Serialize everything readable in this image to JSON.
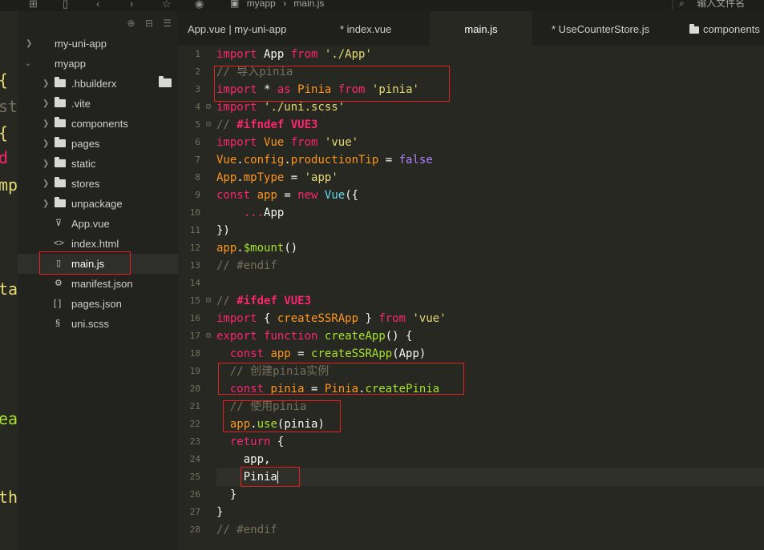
{
  "toolbar": {
    "icons": [
      "new-file-icon",
      "save-icon",
      "back-icon",
      "forward-icon",
      "star-icon",
      "run-icon"
    ],
    "breadcrumb": [
      "myapp",
      "main.js"
    ],
    "file_search_placeholder": "输入文件名"
  },
  "sidebar": {
    "items": [
      {
        "label": "my-uni-app",
        "type": "project",
        "icon": "chevron-right-icon"
      },
      {
        "label": "myapp",
        "type": "project",
        "icon": "chevron-down-icon"
      },
      {
        "label": ".hbuilderx",
        "type": "folder",
        "icon": "folder-icon"
      },
      {
        "label": ".vite",
        "type": "folder",
        "icon": "folder-icon"
      },
      {
        "label": "components",
        "type": "folder",
        "icon": "folder-icon"
      },
      {
        "label": "pages",
        "type": "folder",
        "icon": "folder-icon"
      },
      {
        "label": "static",
        "type": "folder",
        "icon": "folder-icon"
      },
      {
        "label": "stores",
        "type": "folder",
        "icon": "folder-icon"
      },
      {
        "label": "unpackage",
        "type": "folder",
        "icon": "folder-icon"
      },
      {
        "label": "App.vue",
        "type": "file",
        "icon": "vue-file-icon"
      },
      {
        "label": "index.html",
        "type": "file",
        "icon": "html-file-icon"
      },
      {
        "label": "main.js",
        "type": "file",
        "icon": "js-file-icon"
      },
      {
        "label": "manifest.json",
        "type": "file",
        "icon": "manifest-file-icon"
      },
      {
        "label": "pages.json",
        "type": "file",
        "icon": "json-file-icon"
      },
      {
        "label": "uni.scss",
        "type": "file",
        "icon": "scss-file-icon"
      }
    ]
  },
  "left_strip": [
    "{",
    "st",
    "{",
    "d",
    "mp",
    "ta",
    "ea",
    "th"
  ],
  "tabs": [
    {
      "label": "App.vue | my-uni-app"
    },
    {
      "label": "* index.vue"
    },
    {
      "label": "main.js"
    },
    {
      "label": "* UseCounterStore.js"
    },
    {
      "label": "components"
    }
  ],
  "editor": {
    "line_numbers": [
      "1",
      "2",
      "3",
      "4",
      "5",
      "6",
      "7",
      "8",
      "9",
      "10",
      "11",
      "12",
      "13",
      "14",
      "15",
      "16",
      "17",
      "18",
      "19",
      "20",
      "21",
      "22",
      "23",
      "24",
      "25",
      "26",
      "27",
      "28"
    ],
    "tokens": [
      [
        [
          "kw",
          "import"
        ],
        [
          "pl",
          " App "
        ],
        [
          "kw",
          "from"
        ],
        [
          "pl",
          " "
        ],
        [
          "str",
          "'./App'"
        ]
      ],
      [
        [
          "com",
          "// 导入pinia"
        ]
      ],
      [
        [
          "kw",
          "import"
        ],
        [
          "pl",
          " * "
        ],
        [
          "kw",
          "as"
        ],
        [
          "pl",
          " "
        ],
        [
          "var",
          "Pinia"
        ],
        [
          "pl",
          " "
        ],
        [
          "kw",
          "from"
        ],
        [
          "pl",
          " "
        ],
        [
          "str",
          "'pinia'"
        ]
      ],
      [
        [
          "kw",
          "import"
        ],
        [
          "pl",
          " "
        ],
        [
          "str",
          "'./uni.scss'"
        ]
      ],
      [
        [
          "com",
          "// "
        ],
        [
          "dir",
          "#ifndef VUE3"
        ]
      ],
      [
        [
          "kw",
          "import"
        ],
        [
          "pl",
          " "
        ],
        [
          "var",
          "Vue"
        ],
        [
          "pl",
          " "
        ],
        [
          "kw",
          "from"
        ],
        [
          "pl",
          " "
        ],
        [
          "str",
          "'vue'"
        ]
      ],
      [
        [
          "var",
          "Vue"
        ],
        [
          "pl",
          "."
        ],
        [
          "var",
          "config"
        ],
        [
          "pl",
          "."
        ],
        [
          "var",
          "productionTip"
        ],
        [
          "pl",
          " = "
        ],
        [
          "bool",
          "false"
        ]
      ],
      [
        [
          "var",
          "App"
        ],
        [
          "pl",
          "."
        ],
        [
          "var",
          "mpType"
        ],
        [
          "pl",
          " = "
        ],
        [
          "str",
          "'app'"
        ]
      ],
      [
        [
          "kw",
          "const"
        ],
        [
          "pl",
          " "
        ],
        [
          "var",
          "app"
        ],
        [
          "pl",
          " = "
        ],
        [
          "kw",
          "new"
        ],
        [
          "pl",
          " "
        ],
        [
          "bi",
          "Vue"
        ],
        [
          "pl",
          "({"
        ]
      ],
      [
        [
          "pl",
          "    "
        ],
        [
          "kw",
          "..."
        ],
        [
          "pl",
          "App"
        ]
      ],
      [
        [
          "pl",
          "})"
        ]
      ],
      [
        [
          "var",
          "app"
        ],
        [
          "pl",
          "."
        ],
        [
          "fn",
          "$mount"
        ],
        [
          "pl",
          "()"
        ]
      ],
      [
        [
          "com",
          "// #endif"
        ]
      ],
      [],
      [
        [
          "com",
          "// "
        ],
        [
          "dir",
          "#ifdef VUE3"
        ]
      ],
      [
        [
          "kw",
          "import"
        ],
        [
          "pl",
          " { "
        ],
        [
          "var",
          "createSSRApp"
        ],
        [
          "pl",
          " } "
        ],
        [
          "kw",
          "from"
        ],
        [
          "pl",
          " "
        ],
        [
          "str",
          "'vue'"
        ]
      ],
      [
        [
          "kw",
          "export"
        ],
        [
          "pl",
          " "
        ],
        [
          "kw",
          "function"
        ],
        [
          "pl",
          " "
        ],
        [
          "fn",
          "createApp"
        ],
        [
          "pl",
          "() {"
        ]
      ],
      [
        [
          "pl",
          "  "
        ],
        [
          "kw",
          "const"
        ],
        [
          "pl",
          " "
        ],
        [
          "var",
          "app"
        ],
        [
          "pl",
          " = "
        ],
        [
          "fn",
          "createSSRApp"
        ],
        [
          "pl",
          "(App)"
        ]
      ],
      [
        [
          "pl",
          "  "
        ],
        [
          "com",
          "// 创建pinia实例"
        ]
      ],
      [
        [
          "pl",
          "  "
        ],
        [
          "kw",
          "const"
        ],
        [
          "pl",
          " "
        ],
        [
          "var",
          "pinia"
        ],
        [
          "pl",
          " = "
        ],
        [
          "var",
          "Pinia"
        ],
        [
          "pl",
          "."
        ],
        [
          "fn",
          "createPinia"
        ]
      ],
      [
        [
          "pl",
          "  "
        ],
        [
          "com",
          "// 使用pinia"
        ]
      ],
      [
        [
          "pl",
          "  "
        ],
        [
          "var",
          "app"
        ],
        [
          "pl",
          "."
        ],
        [
          "fn",
          "use"
        ],
        [
          "pl",
          "(pinia)"
        ]
      ],
      [
        [
          "pl",
          "  "
        ],
        [
          "kw",
          "return"
        ],
        [
          "pl",
          " {"
        ]
      ],
      [
        [
          "pl",
          "    app,"
        ]
      ],
      [
        [
          "pl",
          "    Pinia"
        ]
      ],
      [
        [
          "pl",
          "  }"
        ]
      ],
      [
        [
          "pl",
          "}"
        ]
      ],
      [
        [
          "com",
          "// #endif"
        ]
      ]
    ]
  },
  "colors": {
    "editor_bg": "#272822",
    "sidebar_bg": "#22231e",
    "keyword": "#f92672",
    "string": "#e6db74",
    "comment": "#75715e",
    "function": "#a6e22e",
    "variable": "#fd971f",
    "builtin": "#66d9ef",
    "highlight_box": "#e52222"
  }
}
